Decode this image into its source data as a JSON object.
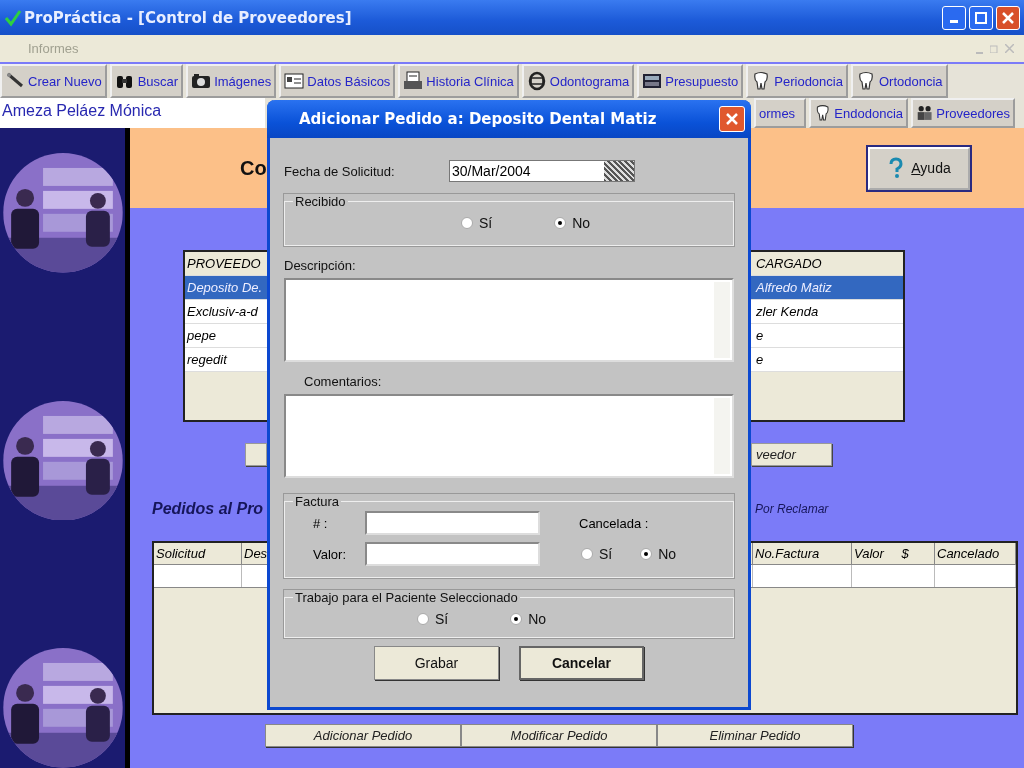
{
  "window": {
    "title": "ProPráctica - [Control de Proveedores]"
  },
  "menu": [
    {
      "label": "Informes",
      "disabled": true
    }
  ],
  "toolbar": [
    {
      "label": "Crear Nuevo"
    },
    {
      "label": "Buscar"
    },
    {
      "label": "Imágenes"
    },
    {
      "label": "Datos Básicos"
    },
    {
      "label": "Historia Clínica"
    },
    {
      "label": "Odontograma"
    },
    {
      "label": "Presupuesto"
    },
    {
      "label": "Periodoncia"
    },
    {
      "label": "Ortodoncia"
    }
  ],
  "patient_name": "Ameza Peláez Mónica",
  "toolbar_row2": [
    {
      "label": "ormes"
    },
    {
      "label": "Endodoncia"
    },
    {
      "label": "Proveedores"
    }
  ],
  "header": {
    "title": "Co",
    "help_button": "Ayuda"
  },
  "providers_table": {
    "columns": [
      "PROVEEDO",
      "CARGADO"
    ],
    "rows": [
      {
        "cells": [
          "Deposito De.",
          "Alfredo Matiz"
        ],
        "selected": true
      },
      {
        "cells": [
          "Exclusiv-a-d",
          "zler Kenda"
        ],
        "selected": false
      },
      {
        "cells": [
          "pepe",
          "e"
        ],
        "selected": false
      },
      {
        "cells": [
          "regedit",
          "e"
        ],
        "selected": false
      }
    ]
  },
  "provider_button": "veedor",
  "orders_title": "Pedidos al Pro",
  "orders_filter": "Por Reclamar",
  "orders_table": {
    "columns": [
      "Solicitud",
      "Des",
      "No.Factura",
      "Valor $",
      "Cancelado"
    ]
  },
  "order_buttons": [
    "Adicionar Pedido",
    "Modificar Pedido",
    "Eliminar Pedido"
  ],
  "dialog": {
    "title": "Adicionar Pedido a: Deposito Dental Matiz",
    "date_label": "Fecha de Solicitud:",
    "date_value": "30/Mar/2004",
    "received": {
      "legend": "Recibido",
      "options": [
        {
          "label": "Sí",
          "selected": false
        },
        {
          "label": "No",
          "selected": true
        }
      ]
    },
    "description_label": "Descripción:",
    "comments_label": "Comentarios:",
    "invoice": {
      "legend": "Factura",
      "number_label": "# :",
      "value_label": "Valor:",
      "cancelled_label": "Cancelada :",
      "options": [
        {
          "label": "Sí",
          "selected": false
        },
        {
          "label": "No",
          "selected": true
        }
      ]
    },
    "patient_work": {
      "legend": "Trabajo para el Paciente Seleccionado",
      "options": [
        {
          "label": "Sí",
          "selected": false
        },
        {
          "label": "No",
          "selected": true
        }
      ]
    },
    "buttons": [
      {
        "label": "Grabar",
        "default": false
      },
      {
        "label": "Cancelar",
        "default": true
      }
    ]
  }
}
